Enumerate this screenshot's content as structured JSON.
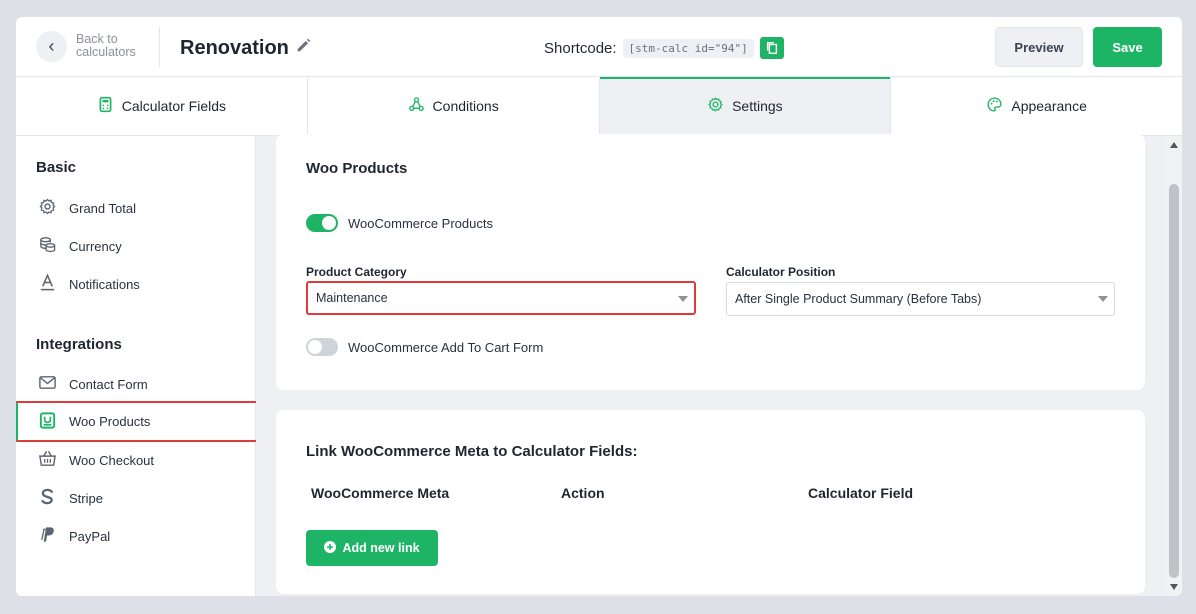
{
  "header": {
    "back_label": "Back to calculators",
    "title": "Renovation",
    "shortcode_label": "Shortcode:",
    "shortcode_value": "[stm-calc id=\"94\"]",
    "preview_label": "Preview",
    "save_label": "Save"
  },
  "tabs": [
    {
      "label": "Calculator Fields",
      "icon": "calculator-icon"
    },
    {
      "label": "Conditions",
      "icon": "conditions-icon"
    },
    {
      "label": "Settings",
      "icon": "gear-icon",
      "active": true
    },
    {
      "label": "Appearance",
      "icon": "palette-icon"
    }
  ],
  "sidebar": {
    "basic_heading": "Basic",
    "basic_items": [
      {
        "label": "Grand Total",
        "icon": "gear-icon"
      },
      {
        "label": "Currency",
        "icon": "coins-icon"
      },
      {
        "label": "Notifications",
        "icon": "text-a-icon"
      }
    ],
    "integrations_heading": "Integrations",
    "integration_items": [
      {
        "label": "Contact Form",
        "icon": "envelope-icon"
      },
      {
        "label": "Woo Products",
        "icon": "woo-box-icon",
        "active": true
      },
      {
        "label": "Woo Checkout",
        "icon": "basket-icon"
      },
      {
        "label": "Stripe",
        "icon": "stripe-icon"
      },
      {
        "label": "PayPal",
        "icon": "paypal-icon"
      }
    ]
  },
  "woo_products": {
    "title": "Woo Products",
    "toggle_products_label": "WooCommerce Products",
    "toggle_products_on": true,
    "product_category_label": "Product Category",
    "product_category_value": "Maintenance",
    "calculator_position_label": "Calculator Position",
    "calculator_position_value": "After Single Product Summary (Before Tabs)",
    "toggle_cart_label": "WooCommerce Add To Cart Form",
    "toggle_cart_on": false
  },
  "meta_link": {
    "title": "Link WooCommerce Meta to Calculator Fields:",
    "columns": [
      "WooCommerce Meta",
      "Action",
      "Calculator Field"
    ],
    "add_button_label": "Add new link"
  },
  "colors": {
    "accent": "#1db565",
    "highlight": "#e03b3b"
  }
}
